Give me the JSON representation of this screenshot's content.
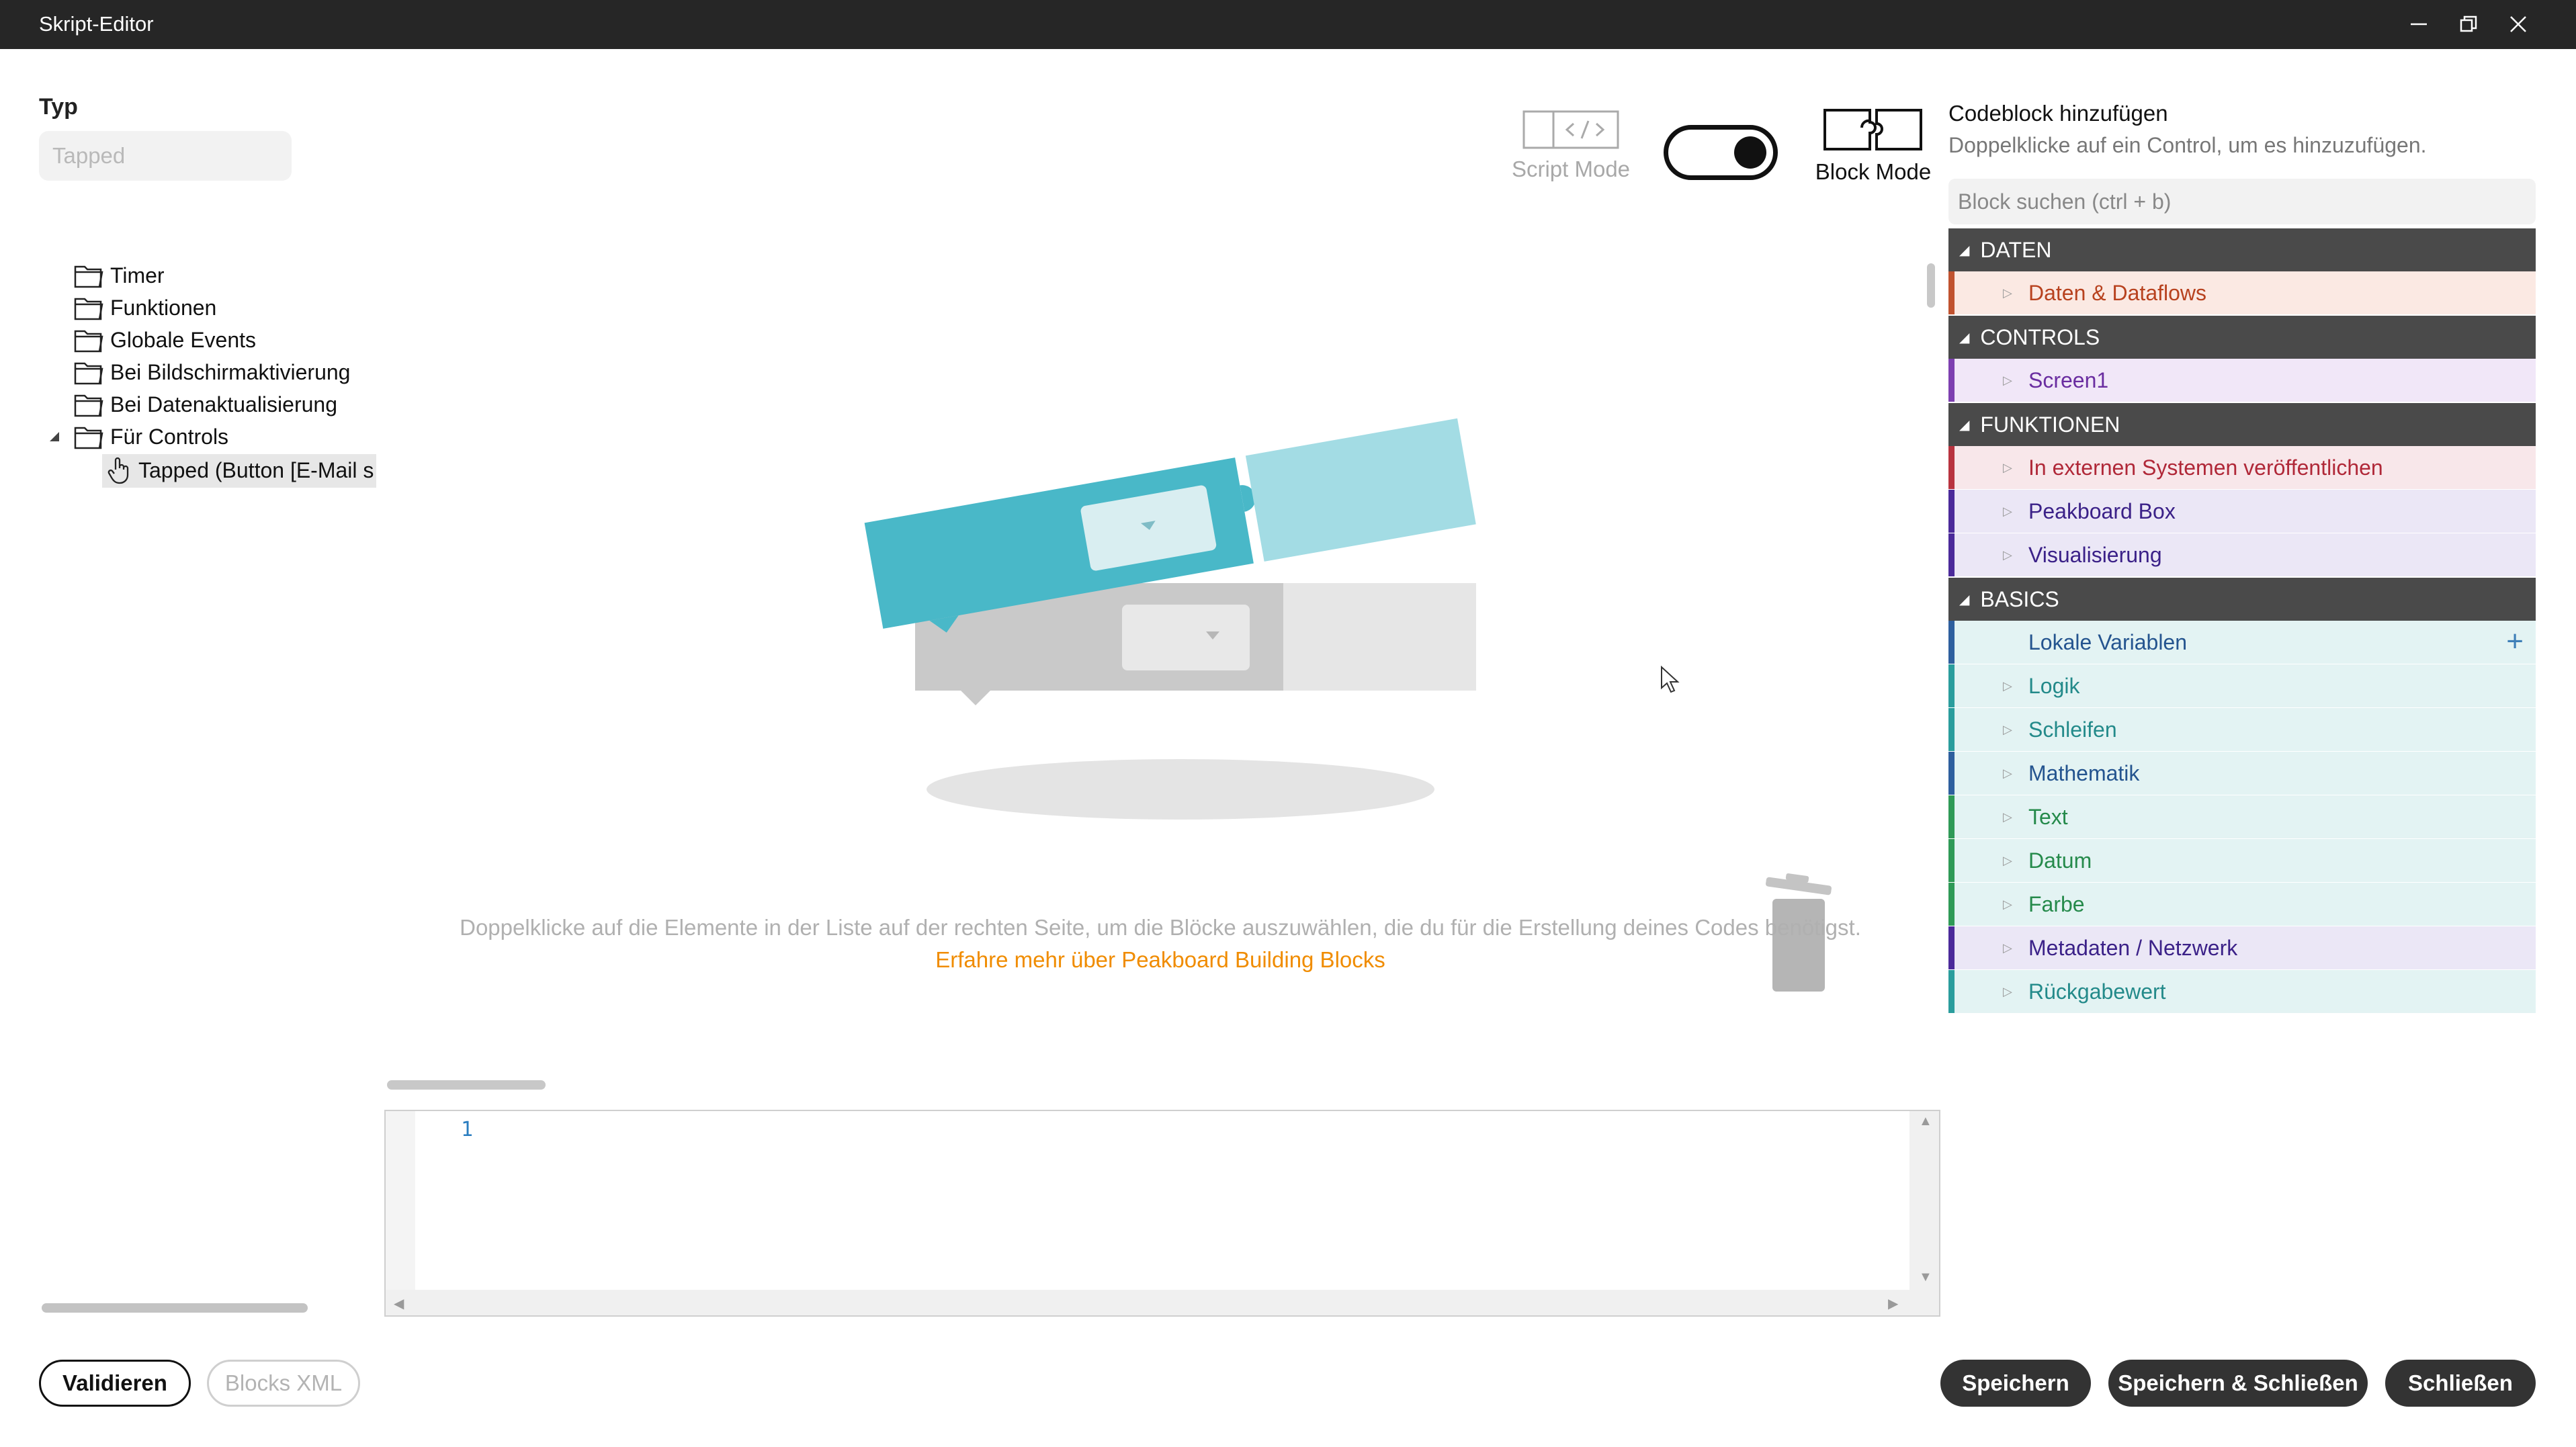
{
  "window": {
    "title": "Skript-Editor"
  },
  "left": {
    "type_label": "Typ",
    "type_placeholder": "Tapped",
    "tree": [
      {
        "label": "Timer",
        "icon": "folder-icon"
      },
      {
        "label": "Funktionen",
        "icon": "folder-icon"
      },
      {
        "label": "Globale Events",
        "icon": "folder-icon"
      },
      {
        "label": "Bei Bildschirmaktivierung",
        "icon": "folder-icon"
      },
      {
        "label": "Bei Datenaktualisierung",
        "icon": "folder-icon"
      },
      {
        "label": "Für Controls",
        "icon": "folder-icon",
        "expanded": true
      },
      {
        "label": "Tapped (Button [E-Mail s",
        "icon": "hand-pointer-icon",
        "selected": true
      }
    ]
  },
  "modes": {
    "script_label": "Script Mode",
    "block_label": "Block Mode",
    "active": "Block Mode"
  },
  "canvas": {
    "hint": "Doppelklicke auf die Elemente in der Liste auf der rechten Seite, um die Blöcke auszuwählen, die du für die Erstellung deines Codes benötigst.",
    "learn_more": "Erfahre mehr über Peakboard Building Blocks"
  },
  "code_editor": {
    "line_number": "1"
  },
  "right": {
    "title": "Codeblock hinzufügen",
    "subtitle": "Doppelklicke auf ein Control, um es hinzuzufügen.",
    "search_placeholder": "Block suchen (ctrl + b)",
    "categories": {
      "daten": "DATEN",
      "controls": "CONTROLS",
      "funktionen": "FUNKTIONEN",
      "basics": "BASICS"
    },
    "items": {
      "daten_dataflows": "Daten & Dataflows",
      "screen1": "Screen1",
      "externe_systeme": "In externen Systemen veröffentlichen",
      "peakboard_box": "Peakboard Box",
      "visualisierung": "Visualisierung",
      "lokale_variablen": "Lokale Variablen",
      "logik": "Logik",
      "schleifen": "Schleifen",
      "mathematik": "Mathematik",
      "text": "Text",
      "datum": "Datum",
      "farbe": "Farbe",
      "metadaten": "Metadaten / Netzwerk",
      "rueckgabewert": "Rückgabewert"
    },
    "colors": {
      "category_bg": "#4a4a4a",
      "daten": "#c0522f",
      "controls": "#7d3fb0",
      "funktionen_red": "#b8333f",
      "funktionen_purple": "#4b2a9a",
      "basics_blue": "#2e5f9e",
      "basics_teal": "#2a9d9d",
      "basics_green": "#2f9a57"
    }
  },
  "footer": {
    "validate": "Validieren",
    "blocks_xml": "Blocks XML",
    "save": "Speichern",
    "save_close": "Speichern & Schließen",
    "close": "Schließen"
  }
}
